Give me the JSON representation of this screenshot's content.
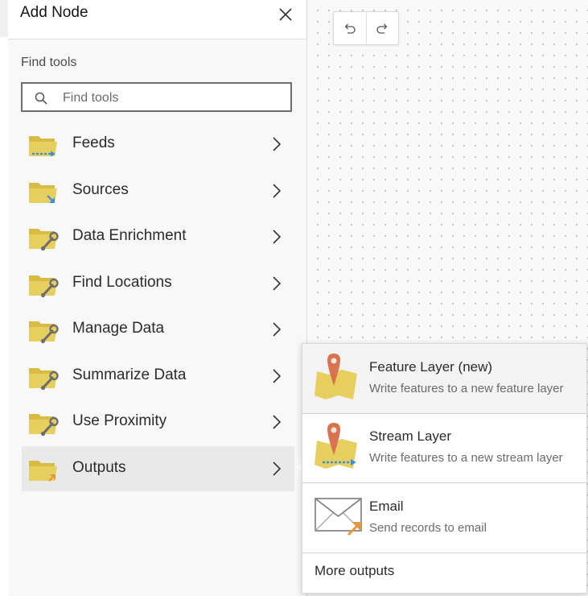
{
  "panel": {
    "title": "Add Node",
    "find_label": "Find tools",
    "search_placeholder": "Find tools"
  },
  "categories": [
    {
      "label": "Feeds",
      "icon": "folder-feed-icon"
    },
    {
      "label": "Sources",
      "icon": "folder-source-icon"
    },
    {
      "label": "Data Enrichment",
      "icon": "folder-tool-icon"
    },
    {
      "label": "Find Locations",
      "icon": "folder-tool-icon"
    },
    {
      "label": "Manage Data",
      "icon": "folder-tool-icon"
    },
    {
      "label": "Summarize Data",
      "icon": "folder-tool-icon"
    },
    {
      "label": "Use Proximity",
      "icon": "folder-tool-icon"
    },
    {
      "label": "Outputs",
      "icon": "folder-output-icon",
      "active": true
    }
  ],
  "outputs": {
    "items": [
      {
        "title": "Feature Layer (new)",
        "description": "Write features to a new feature layer",
        "icon": "feature-layer-icon"
      },
      {
        "title": "Stream Layer",
        "description": "Write features to a new stream layer",
        "icon": "stream-layer-icon"
      },
      {
        "title": "Email",
        "description": "Send records to email",
        "icon": "email-icon"
      }
    ],
    "more_label": "More outputs"
  },
  "colors": {
    "folder": "#e6cf5f",
    "arrow_blue": "#3b8fd9",
    "arrow_orange": "#e8963a",
    "pin": "#d7744f"
  }
}
